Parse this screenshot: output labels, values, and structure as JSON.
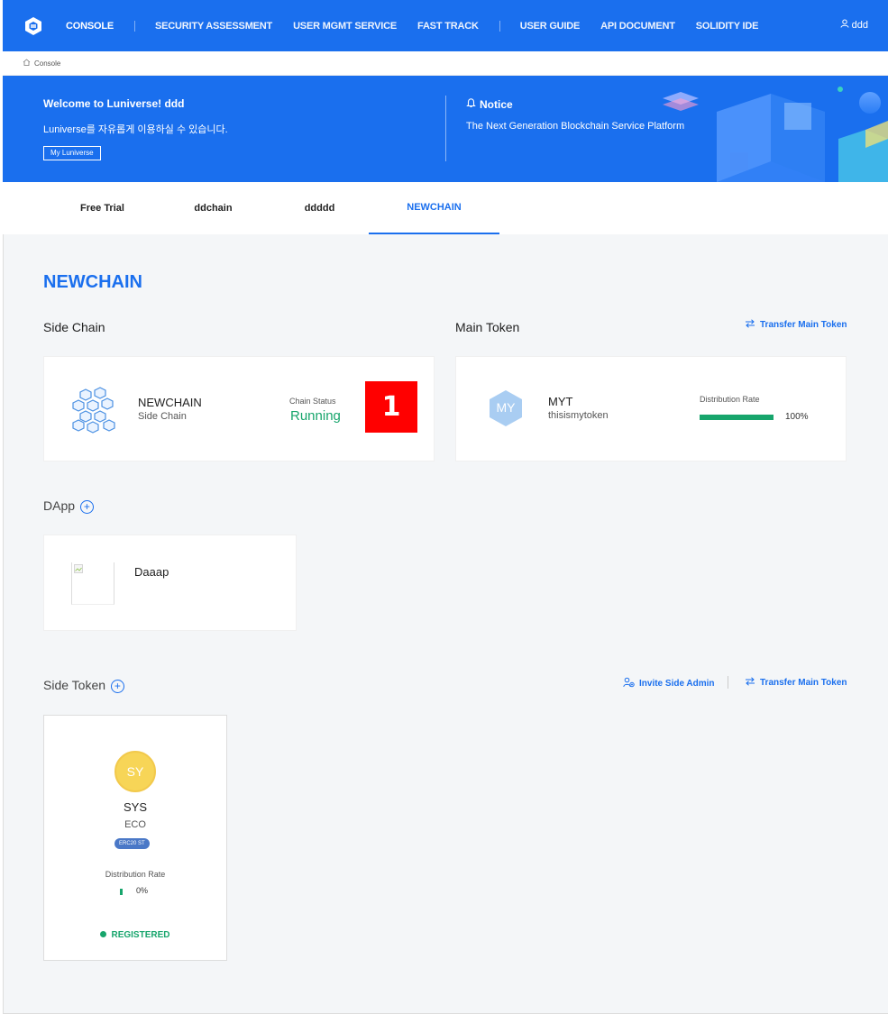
{
  "nav": {
    "items": [
      {
        "label": "CONSOLE"
      },
      {
        "label": "SECURITY ASSESSMENT"
      },
      {
        "label": "USER MGMT SERVICE"
      },
      {
        "label": "FAST TRACK"
      },
      {
        "label": "USER GUIDE"
      },
      {
        "label": "API DOCUMENT"
      },
      {
        "label": "SOLIDITY IDE"
      }
    ],
    "user": "ddd"
  },
  "breadcrumb": {
    "label": "Console"
  },
  "banner": {
    "welcome": "Welcome to Luniverse! ddd",
    "subtitle": "Luniverse를 자유롭게 이용하실 수 있습니다.",
    "button": "My Luniverse",
    "notice_title": "Notice",
    "notice_text": "The Next Generation Blockchain Service Platform"
  },
  "tabs": [
    {
      "label": "Free Trial"
    },
    {
      "label": "ddchain"
    },
    {
      "label": "ddddd"
    },
    {
      "label": "NEWCHAIN"
    }
  ],
  "main": {
    "chain_title": "NEWCHAIN",
    "side_chain_label": "Side Chain",
    "main_token_label": "Main Token",
    "transfer_main_token": "Transfer Main Token",
    "side_chain": {
      "name": "NEWCHAIN",
      "type": "Side Chain",
      "status_label": "Chain Status",
      "status": "Running"
    },
    "marker": "1",
    "main_token": {
      "avatar": "MY",
      "symbol": "MYT",
      "name": "thisismytoken",
      "rate_label": "Distribution Rate",
      "rate_text": "100%",
      "rate_value": 1.0
    },
    "dapp_label": "DApp",
    "dapp": {
      "name": "Daaap"
    },
    "side_token_label": "Side Token",
    "invite_side_admin": "Invite Side Admin",
    "transfer_main_token_2": "Transfer Main Token",
    "side_token": {
      "avatar": "SY",
      "symbol": "SYS",
      "name": "ECO",
      "badge": "ERC20 ST",
      "rate_label": "Distribution Rate",
      "rate_text": "0%",
      "rate_value": 0.0,
      "status": "REGISTERED"
    }
  },
  "colors": {
    "primary": "#1a6fee",
    "success": "#17a56c",
    "marker": "#ff0000",
    "token_yellow": "#f7d557"
  }
}
